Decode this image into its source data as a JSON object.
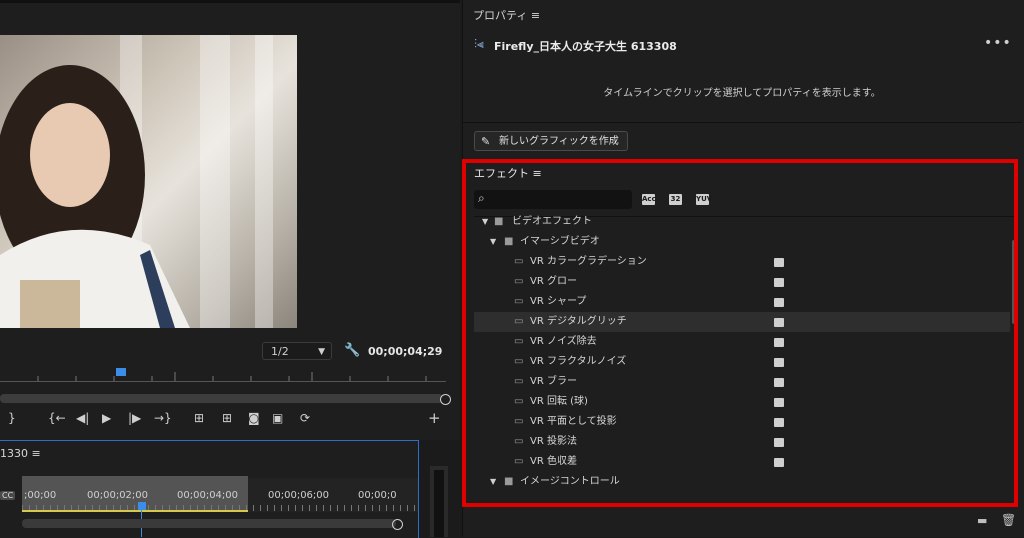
{
  "monitor": {
    "zoom_value": "1/2",
    "timecode": "00;00;04;29",
    "tools": [
      "{",
      "{←",
      "◀|",
      "▶",
      "|▶",
      "→}",
      "⊞",
      "⊞",
      "camera",
      "compare",
      "export",
      "+"
    ]
  },
  "timeline": {
    "title": "1330 ≡",
    "cc": "CC",
    "timecodes": [
      ";00;00",
      "00;00;02;00",
      "00;00;04;00",
      "00;00;06;00",
      "00;00;0"
    ]
  },
  "properties": {
    "title": "プロパティ ≡",
    "clip_name": "Firefly_日本人の女子大生 613308",
    "more": "•••",
    "message": "タイムラインでクリップを選択してプロパティを表示します。",
    "new_graphic": "新しいグラフィックを作成"
  },
  "effects": {
    "title": "エフェクト ≡",
    "search_placeholder": "",
    "filter_badges": [
      "Acc",
      "32",
      "YUV"
    ],
    "tree": [
      {
        "level": 0,
        "type": "folder",
        "label": "ビデオエフェクト"
      },
      {
        "level": 1,
        "type": "folder",
        "label": "イマーシブビデオ"
      },
      {
        "level": 2,
        "type": "effect",
        "label": "VR カラーグラデーション"
      },
      {
        "level": 2,
        "type": "effect",
        "label": "VR グロー"
      },
      {
        "level": 2,
        "type": "effect",
        "label": "VR シャープ"
      },
      {
        "level": 2,
        "type": "effect",
        "label": "VR デジタルグリッチ",
        "selected": true
      },
      {
        "level": 2,
        "type": "effect",
        "label": "VR ノイズ除去"
      },
      {
        "level": 2,
        "type": "effect",
        "label": "VR フラクタルノイズ"
      },
      {
        "level": 2,
        "type": "effect",
        "label": "VR ブラー"
      },
      {
        "level": 2,
        "type": "effect",
        "label": "VR 回転 (球)"
      },
      {
        "level": 2,
        "type": "effect",
        "label": "VR 平面として投影"
      },
      {
        "level": 2,
        "type": "effect",
        "label": "VR 投影法"
      },
      {
        "level": 2,
        "type": "effect",
        "label": "VR 色収差"
      },
      {
        "level": 1,
        "type": "folder",
        "label": "イメージコントロール"
      }
    ]
  },
  "colors": {
    "accent_blue": "#3b8de8",
    "highlight_red": "#e00000",
    "panel_bg": "#1e1e1e"
  }
}
